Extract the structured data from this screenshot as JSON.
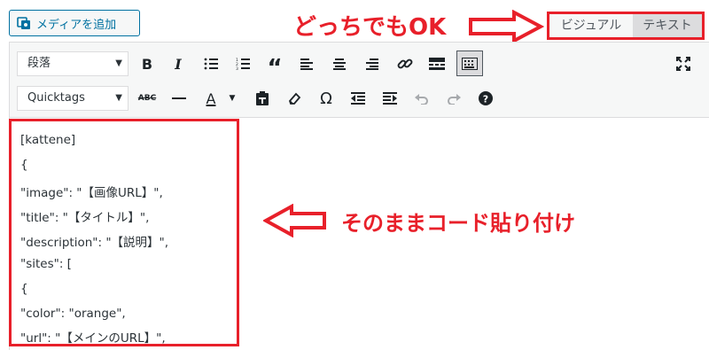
{
  "media_button": {
    "label": "メディアを追加",
    "icon": "media-icon"
  },
  "callouts": {
    "top": "どっちでもOK",
    "middle": "そのままコード貼り付け",
    "accent_color": "#e8202a"
  },
  "tabs": {
    "visual": "ビジュアル",
    "text": "テキスト"
  },
  "toolbar": {
    "format_select": "段落",
    "quicktags_select": "Quicktags",
    "row1_icons": [
      "bold-icon",
      "italic-icon",
      "bullet-list-icon",
      "numbered-list-icon",
      "blockquote-icon",
      "align-left-icon",
      "align-center-icon",
      "align-right-icon",
      "link-icon",
      "read-more-icon",
      "toolbar-toggle-icon",
      "fullscreen-icon"
    ],
    "row2_icons": [
      "strikethrough-icon",
      "horizontal-line-icon",
      "text-color-icon",
      "paste-text-icon",
      "clear-formatting-icon",
      "special-character-icon",
      "outdent-icon",
      "indent-icon",
      "undo-icon",
      "redo-icon",
      "help-icon"
    ]
  },
  "editor": {
    "lines": [
      "[kattene]",
      "{",
      "\"image\": \"【画像URL】\",",
      "\"title\": \"【タイトル】\",",
      "\"description\": \"【説明】\",",
      "\"sites\": [",
      "{",
      "\"color\": \"orange\",",
      "\"url\": \"【メインのURL】\","
    ]
  }
}
